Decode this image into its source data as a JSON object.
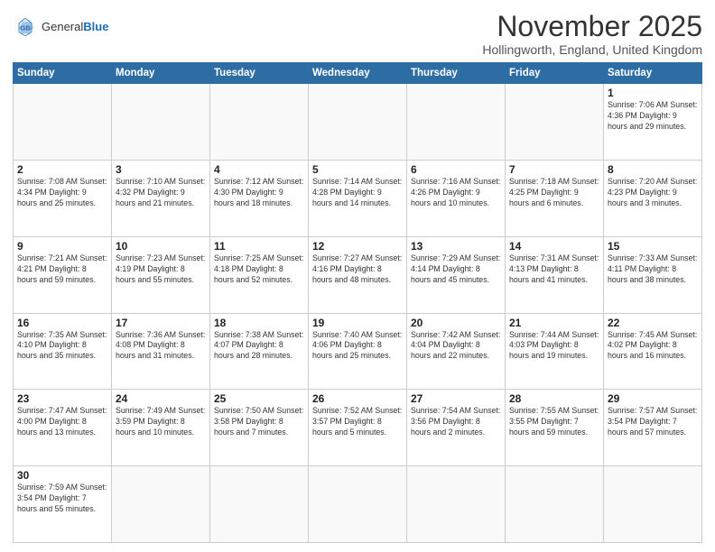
{
  "header": {
    "logo_general": "General",
    "logo_blue": "Blue",
    "month_title": "November 2025",
    "subtitle": "Hollingworth, England, United Kingdom"
  },
  "days_of_week": [
    "Sunday",
    "Monday",
    "Tuesday",
    "Wednesday",
    "Thursday",
    "Friday",
    "Saturday"
  ],
  "weeks": [
    [
      {
        "day": "",
        "info": ""
      },
      {
        "day": "",
        "info": ""
      },
      {
        "day": "",
        "info": ""
      },
      {
        "day": "",
        "info": ""
      },
      {
        "day": "",
        "info": ""
      },
      {
        "day": "",
        "info": ""
      },
      {
        "day": "1",
        "info": "Sunrise: 7:06 AM\nSunset: 4:36 PM\nDaylight: 9 hours and 29 minutes."
      }
    ],
    [
      {
        "day": "2",
        "info": "Sunrise: 7:08 AM\nSunset: 4:34 PM\nDaylight: 9 hours and 25 minutes."
      },
      {
        "day": "3",
        "info": "Sunrise: 7:10 AM\nSunset: 4:32 PM\nDaylight: 9 hours and 21 minutes."
      },
      {
        "day": "4",
        "info": "Sunrise: 7:12 AM\nSunset: 4:30 PM\nDaylight: 9 hours and 18 minutes."
      },
      {
        "day": "5",
        "info": "Sunrise: 7:14 AM\nSunset: 4:28 PM\nDaylight: 9 hours and 14 minutes."
      },
      {
        "day": "6",
        "info": "Sunrise: 7:16 AM\nSunset: 4:26 PM\nDaylight: 9 hours and 10 minutes."
      },
      {
        "day": "7",
        "info": "Sunrise: 7:18 AM\nSunset: 4:25 PM\nDaylight: 9 hours and 6 minutes."
      },
      {
        "day": "8",
        "info": "Sunrise: 7:20 AM\nSunset: 4:23 PM\nDaylight: 9 hours and 3 minutes."
      }
    ],
    [
      {
        "day": "9",
        "info": "Sunrise: 7:21 AM\nSunset: 4:21 PM\nDaylight: 8 hours and 59 minutes."
      },
      {
        "day": "10",
        "info": "Sunrise: 7:23 AM\nSunset: 4:19 PM\nDaylight: 8 hours and 55 minutes."
      },
      {
        "day": "11",
        "info": "Sunrise: 7:25 AM\nSunset: 4:18 PM\nDaylight: 8 hours and 52 minutes."
      },
      {
        "day": "12",
        "info": "Sunrise: 7:27 AM\nSunset: 4:16 PM\nDaylight: 8 hours and 48 minutes."
      },
      {
        "day": "13",
        "info": "Sunrise: 7:29 AM\nSunset: 4:14 PM\nDaylight: 8 hours and 45 minutes."
      },
      {
        "day": "14",
        "info": "Sunrise: 7:31 AM\nSunset: 4:13 PM\nDaylight: 8 hours and 41 minutes."
      },
      {
        "day": "15",
        "info": "Sunrise: 7:33 AM\nSunset: 4:11 PM\nDaylight: 8 hours and 38 minutes."
      }
    ],
    [
      {
        "day": "16",
        "info": "Sunrise: 7:35 AM\nSunset: 4:10 PM\nDaylight: 8 hours and 35 minutes."
      },
      {
        "day": "17",
        "info": "Sunrise: 7:36 AM\nSunset: 4:08 PM\nDaylight: 8 hours and 31 minutes."
      },
      {
        "day": "18",
        "info": "Sunrise: 7:38 AM\nSunset: 4:07 PM\nDaylight: 8 hours and 28 minutes."
      },
      {
        "day": "19",
        "info": "Sunrise: 7:40 AM\nSunset: 4:06 PM\nDaylight: 8 hours and 25 minutes."
      },
      {
        "day": "20",
        "info": "Sunrise: 7:42 AM\nSunset: 4:04 PM\nDaylight: 8 hours and 22 minutes."
      },
      {
        "day": "21",
        "info": "Sunrise: 7:44 AM\nSunset: 4:03 PM\nDaylight: 8 hours and 19 minutes."
      },
      {
        "day": "22",
        "info": "Sunrise: 7:45 AM\nSunset: 4:02 PM\nDaylight: 8 hours and 16 minutes."
      }
    ],
    [
      {
        "day": "23",
        "info": "Sunrise: 7:47 AM\nSunset: 4:00 PM\nDaylight: 8 hours and 13 minutes."
      },
      {
        "day": "24",
        "info": "Sunrise: 7:49 AM\nSunset: 3:59 PM\nDaylight: 8 hours and 10 minutes."
      },
      {
        "day": "25",
        "info": "Sunrise: 7:50 AM\nSunset: 3:58 PM\nDaylight: 8 hours and 7 minutes."
      },
      {
        "day": "26",
        "info": "Sunrise: 7:52 AM\nSunset: 3:57 PM\nDaylight: 8 hours and 5 minutes."
      },
      {
        "day": "27",
        "info": "Sunrise: 7:54 AM\nSunset: 3:56 PM\nDaylight: 8 hours and 2 minutes."
      },
      {
        "day": "28",
        "info": "Sunrise: 7:55 AM\nSunset: 3:55 PM\nDaylight: 7 hours and 59 minutes."
      },
      {
        "day": "29",
        "info": "Sunrise: 7:57 AM\nSunset: 3:54 PM\nDaylight: 7 hours and 57 minutes."
      }
    ],
    [
      {
        "day": "30",
        "info": "Sunrise: 7:59 AM\nSunset: 3:54 PM\nDaylight: 7 hours and 55 minutes."
      },
      {
        "day": "",
        "info": ""
      },
      {
        "day": "",
        "info": ""
      },
      {
        "day": "",
        "info": ""
      },
      {
        "day": "",
        "info": ""
      },
      {
        "day": "",
        "info": ""
      },
      {
        "day": "",
        "info": ""
      }
    ]
  ]
}
